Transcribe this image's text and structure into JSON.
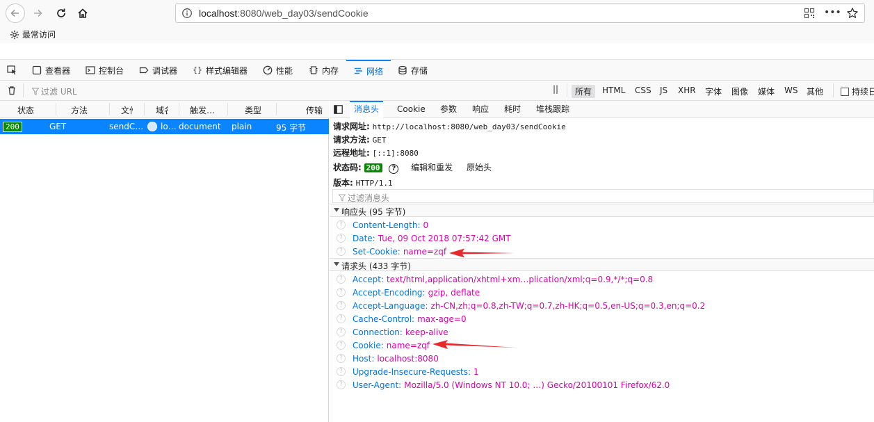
{
  "browser": {
    "url_host": "localhost",
    "url_path": ":8080/web_day03/sendCookie",
    "bookmark_label": "最常访问"
  },
  "devtools": {
    "tabs": [
      {
        "label": "查看器",
        "icon": "inspector-icon"
      },
      {
        "label": "控制台",
        "icon": "console-icon"
      },
      {
        "label": "调试器",
        "icon": "debugger-icon"
      },
      {
        "label": "样式编辑器",
        "icon": "style-editor-icon"
      },
      {
        "label": "性能",
        "icon": "performance-icon"
      },
      {
        "label": "内存",
        "icon": "memory-icon"
      },
      {
        "label": "网络",
        "icon": "network-icon",
        "active": true
      },
      {
        "label": "存储",
        "icon": "storage-icon"
      }
    ],
    "filter_placeholder": "过滤 URL",
    "filter_types": [
      "所有",
      "HTML",
      "CSS",
      "JS",
      "XHR",
      "字体",
      "图像",
      "媒体",
      "WS",
      "其他"
    ],
    "persist_label": "持续日"
  },
  "requests": {
    "columns": [
      "状态",
      "方法",
      "文件",
      "域名",
      "触发…",
      "类型",
      "传输"
    ],
    "rows": [
      {
        "status": "200",
        "method": "GET",
        "file": "sendC…",
        "domain": "lo…",
        "cause": "document",
        "type": "plain",
        "transferred": "95 字节"
      }
    ]
  },
  "details": {
    "tabs": [
      "消息头",
      "Cookie",
      "参数",
      "响应",
      "耗时",
      "堆栈跟踪"
    ],
    "summary": {
      "url_label": "请求网址:",
      "url_value": "http://localhost:8080/web_day03/sendCookie",
      "method_label": "请求方法:",
      "method_value": "GET",
      "remote_label": "远程地址:",
      "remote_value": "[::1]:8080",
      "status_label": "状态码:",
      "status_value": "200",
      "edit_resend": "编辑和重发",
      "raw_headers": "原始头",
      "version_label": "版本:",
      "version_value": "HTTP/1.1"
    },
    "headers_filter_placeholder": "过滤消息头",
    "response_section": "响应头 (95 字节)",
    "response_headers": [
      {
        "name": "Content-Length:",
        "value": "0"
      },
      {
        "name": "Date:",
        "value": "Tue, 09 Oct 2018 07:57:42 GMT"
      },
      {
        "name": "Set-Cookie:",
        "value": "name=zqf"
      }
    ],
    "request_section": "请求头 (433 字节)",
    "request_headers": [
      {
        "name": "Accept:",
        "value": "text/html,application/xhtml+xm…plication/xml;q=0.9,*/*;q=0.8"
      },
      {
        "name": "Accept-Encoding:",
        "value": "gzip, deflate"
      },
      {
        "name": "Accept-Language:",
        "value": "zh-CN,zh;q=0.8,zh-TW;q=0.7,zh-HK;q=0.5,en-US;q=0.3,en;q=0.2"
      },
      {
        "name": "Cache-Control:",
        "value": "max-age=0"
      },
      {
        "name": "Connection:",
        "value": "keep-alive"
      },
      {
        "name": "Cookie:",
        "value": "name=zqf"
      },
      {
        "name": "Host:",
        "value": "localhost:8080"
      },
      {
        "name": "Upgrade-Insecure-Requests:",
        "value": "1"
      },
      {
        "name": "User-Agent:",
        "value": "Mozilla/5.0 (Windows NT 10.0; …) Gecko/20100101 Firefox/62.0"
      }
    ]
  },
  "colors": {
    "accent": "#0a84ff",
    "status_ok": "#058b00",
    "header_name": "#0074e8",
    "header_value": "#dd00a9",
    "annotation_arrow": "#e8282b"
  }
}
